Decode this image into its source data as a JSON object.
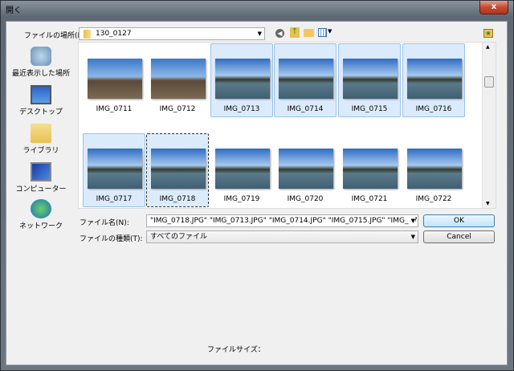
{
  "window": {
    "title": "開く",
    "close_label": "x"
  },
  "location": {
    "label": "ファイルの場所(I):",
    "value": "130_0127"
  },
  "toolbar": {
    "icons": [
      "back-icon",
      "up-folder-icon",
      "new-folder-icon",
      "view-menu-icon"
    ]
  },
  "sidebar": {
    "items": [
      {
        "label": "最近表示した場所",
        "icon": "recent-places-icon"
      },
      {
        "label": "デスクトップ",
        "icon": "desktop-icon"
      },
      {
        "label": "ライブラリ",
        "icon": "libraries-icon"
      },
      {
        "label": "コンピューター",
        "icon": "computer-icon"
      },
      {
        "label": "ネットワーク",
        "icon": "network-icon"
      }
    ]
  },
  "files": [
    {
      "name": "IMG_0711",
      "selected": false
    },
    {
      "name": "IMG_0712",
      "selected": false
    },
    {
      "name": "IMG_0713",
      "selected": true
    },
    {
      "name": "IMG_0714",
      "selected": true
    },
    {
      "name": "IMG_0715",
      "selected": true
    },
    {
      "name": "IMG_0716",
      "selected": true
    },
    {
      "name": "IMG_0717",
      "selected": true
    },
    {
      "name": "IMG_0718",
      "selected": true,
      "focused": true
    },
    {
      "name": "IMG_0719",
      "selected": false
    },
    {
      "name": "IMG_0720",
      "selected": false
    },
    {
      "name": "IMG_0721",
      "selected": false
    },
    {
      "name": "IMG_0722",
      "selected": false
    }
  ],
  "filename": {
    "label": "ファイル名(N):",
    "value": "\"IMG_0718.JPG\" \"IMG_0713.JPG\" \"IMG_0714.JPG\" \"IMG_0715.JPG\" \"IMG_0716.JF"
  },
  "filetype": {
    "label": "ファイルの種類(T):",
    "value": "すべてのファイル"
  },
  "buttons": {
    "ok": "OK",
    "cancel": "Cancel"
  },
  "filesize": {
    "label": "ファイルサイズ："
  }
}
